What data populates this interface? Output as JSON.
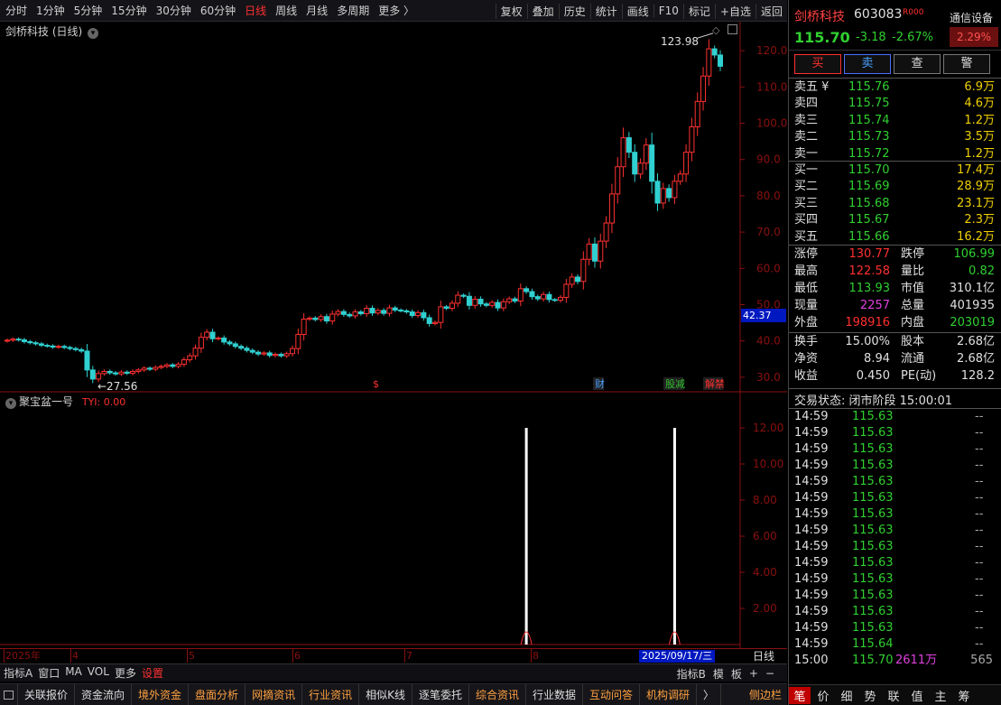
{
  "toolbar": {
    "periods": [
      "分时",
      "1分钟",
      "5分钟",
      "15分钟",
      "30分钟",
      "60分钟",
      "日线",
      "周线",
      "月线",
      "多周期",
      "更多 〉"
    ],
    "active_period": "日线",
    "actions": [
      "复权",
      "叠加",
      "历史",
      "统计",
      "画线",
      "F10",
      "标记",
      "+自选",
      "返回"
    ]
  },
  "chart": {
    "title": "剑桥科技 (日线)",
    "high_label": "123.98",
    "low_label": "←27.56",
    "last_price_tag": "42.37",
    "price_ticks": [
      "120.0",
      "110.0",
      "100.0",
      "90.0",
      "80.0",
      "70.0",
      "60.0",
      "50.0",
      "40.0",
      "30.0"
    ],
    "event_markers": [
      {
        "text": "$",
        "color": "#ff3030"
      },
      {
        "text": "财",
        "color": "#4aa0ff"
      },
      {
        "text": "股减",
        "color": "#30c030"
      },
      {
        "text": "解禁",
        "color": "#ff3030"
      }
    ],
    "indicator_title": "聚宝盆一号",
    "indicator_value": "TYI: 0.00",
    "indicator_ticks": [
      "12.00",
      "10.00",
      "8.00",
      "6.00",
      "4.00",
      "2.00"
    ],
    "time_labels": [
      "2025年",
      "4",
      "5",
      "6",
      "7",
      "8"
    ],
    "cursor_date": "2025/09/17/三",
    "period_label": "日线"
  },
  "chart_data": {
    "type": "candlestick",
    "title": "剑桥科技 (日线)",
    "ylim": [
      24,
      126
    ],
    "y_ticks": [
      30,
      40,
      50,
      60,
      70,
      80,
      90,
      100,
      110,
      120
    ],
    "candles": [
      [
        40,
        40.2
      ],
      [
        40.2,
        40.5
      ],
      [
        40.5,
        40.3
      ],
      [
        40.3,
        39.8
      ],
      [
        39.8,
        39.5
      ],
      [
        39.5,
        39.2
      ],
      [
        39.2,
        38.8
      ],
      [
        38.8,
        38.6
      ],
      [
        38.6,
        38.3
      ],
      [
        38.3,
        38.5
      ],
      [
        38.5,
        38.2
      ],
      [
        38.2,
        37.9
      ],
      [
        37.9,
        37.6
      ],
      [
        37.6,
        37.2
      ],
      [
        37.2,
        32.0
      ],
      [
        32.0,
        29.5
      ],
      [
        29.5,
        31.0
      ],
      [
        31.0,
        31.6
      ],
      [
        31.6,
        31.2
      ],
      [
        31.2,
        30.9
      ],
      [
        30.9,
        31.4
      ],
      [
        31.4,
        31.1
      ],
      [
        31.1,
        31.6
      ],
      [
        31.6,
        32.0
      ],
      [
        32.0,
        32.5
      ],
      [
        32.5,
        32.2
      ],
      [
        32.2,
        32.7
      ],
      [
        32.7,
        33.0
      ],
      [
        33.0,
        33.4
      ],
      [
        33.4,
        33.0
      ],
      [
        33.0,
        33.6
      ],
      [
        33.6,
        34.8
      ],
      [
        34.8,
        35.9
      ],
      [
        35.9,
        38.0
      ],
      [
        38.0,
        41.0
      ],
      [
        41.0,
        42.4
      ],
      [
        42.4,
        40.6
      ],
      [
        40.6,
        40.8
      ],
      [
        40.8,
        39.7
      ],
      [
        39.7,
        39.2
      ],
      [
        39.2,
        38.5
      ],
      [
        38.5,
        38.0
      ],
      [
        38.0,
        37.4
      ],
      [
        37.4,
        36.9
      ],
      [
        36.9,
        36.4
      ],
      [
        36.4,
        36.7
      ],
      [
        36.7,
        36.0
      ],
      [
        36.0,
        36.3
      ],
      [
        36.3,
        35.9
      ],
      [
        35.9,
        36.5
      ],
      [
        36.5,
        37.9
      ],
      [
        37.9,
        41.8
      ],
      [
        41.8,
        46.0
      ],
      [
        46.0,
        46.3
      ],
      [
        46.3,
        45.9
      ],
      [
        45.9,
        46.7
      ],
      [
        46.7,
        45.5
      ],
      [
        45.5,
        47.4
      ],
      [
        47.4,
        48.1
      ],
      [
        48.1,
        47.3
      ],
      [
        47.3,
        46.9
      ],
      [
        46.9,
        48.0
      ],
      [
        48.0,
        47.5
      ],
      [
        47.5,
        49.0
      ],
      [
        49.0,
        47.7
      ],
      [
        47.7,
        48.4
      ],
      [
        48.4,
        47.6
      ],
      [
        47.6,
        49.1
      ],
      [
        49.1,
        48.5
      ],
      [
        48.5,
        48.3
      ],
      [
        48.3,
        48.0
      ],
      [
        48.0,
        47.0
      ],
      [
        47.0,
        47.8
      ],
      [
        47.8,
        46.4
      ],
      [
        46.4,
        44.8
      ],
      [
        44.8,
        45.1
      ],
      [
        45.1,
        49.4
      ],
      [
        49.4,
        49.0
      ],
      [
        49.0,
        50.4
      ],
      [
        50.4,
        52.6
      ],
      [
        52.6,
        52.3
      ],
      [
        52.3,
        49.8
      ],
      [
        49.8,
        51.5
      ],
      [
        51.5,
        50.2
      ],
      [
        50.2,
        49.8
      ],
      [
        49.8,
        50.6
      ],
      [
        50.6,
        49.1
      ],
      [
        49.1,
        50.8
      ],
      [
        50.8,
        51.6
      ],
      [
        51.6,
        51.0
      ],
      [
        51.0,
        54.4
      ],
      [
        54.4,
        53.6
      ],
      [
        53.6,
        52.2
      ],
      [
        52.2,
        51.6
      ],
      [
        51.6,
        52.8
      ],
      [
        52.8,
        51.4
      ],
      [
        51.4,
        51.2
      ],
      [
        51.2,
        52.0
      ],
      [
        52.0,
        55.6
      ],
      [
        55.6,
        57.6
      ],
      [
        57.6,
        56.4
      ],
      [
        56.4,
        62.5
      ],
      [
        62.5,
        66.7
      ],
      [
        66.7,
        62.0
      ],
      [
        62.0,
        67.5
      ],
      [
        67.5,
        72.5
      ],
      [
        72.5,
        80.5
      ],
      [
        80.5,
        88.0
      ],
      [
        88.0,
        96.0
      ],
      [
        96.0,
        92.0
      ],
      [
        92.0,
        86.0
      ],
      [
        86.0,
        89.0
      ],
      [
        89.0,
        94.0
      ],
      [
        94.0,
        84.0
      ],
      [
        84.0,
        78.0
      ],
      [
        78.0,
        82.0
      ],
      [
        82.0,
        79.5
      ],
      [
        79.5,
        84.0
      ],
      [
        84.0,
        86.0
      ],
      [
        86.0,
        92.0
      ],
      [
        92.0,
        99.0
      ],
      [
        99.0,
        106.0
      ],
      [
        106.0,
        113.0
      ],
      [
        113.0,
        120.5
      ],
      [
        120.5,
        118.8
      ],
      [
        118.8,
        115.7
      ]
    ],
    "series": [
      {
        "values": [
          0,
          0,
          0,
          0,
          0,
          0,
          0,
          0,
          0,
          0,
          0,
          0,
          0,
          0,
          0,
          0,
          0,
          0,
          0,
          0,
          0,
          0,
          0,
          0,
          0,
          0,
          0,
          0,
          0,
          0,
          0,
          0,
          0,
          0,
          0,
          0,
          0,
          0,
          0,
          0,
          0,
          0,
          0,
          0,
          0,
          0,
          0,
          0,
          0,
          0,
          0,
          0,
          0,
          0,
          0,
          0,
          0,
          0,
          0,
          0,
          0,
          0,
          0,
          0,
          0,
          0,
          0,
          0,
          0,
          0,
          0,
          0,
          0,
          0,
          0,
          0,
          0,
          0,
          0,
          0,
          0,
          0,
          0,
          0,
          0,
          0,
          0,
          0,
          0,
          0,
          0,
          0,
          0,
          0,
          0,
          0,
          0,
          0,
          0,
          0,
          0,
          0,
          0,
          0,
          0,
          0,
          0,
          0,
          0,
          0,
          0,
          0,
          0,
          0,
          0,
          0,
          0,
          0,
          0,
          0,
          0,
          0,
          0,
          0,
          0,
          0
        ]
      }
    ],
    "indicator_spikes": [
      {
        "index": 91,
        "value": 12
      },
      {
        "index": 117,
        "value": 12
      }
    ],
    "indicator_ylim": [
      0,
      13
    ]
  },
  "quote": {
    "name": "剑桥科技",
    "code": "603083",
    "tag": "R000",
    "device": "通信设备",
    "price": "115.70",
    "change": "-3.18",
    "pct": "-2.67%",
    "device_pct": "2.29%",
    "buttons": [
      "买",
      "卖",
      "查",
      "警"
    ],
    "asks": [
      {
        "label": "卖五 ¥",
        "price": "115.76",
        "vol": "6.9万"
      },
      {
        "label": "卖四",
        "price": "115.75",
        "vol": "4.6万"
      },
      {
        "label": "卖三",
        "price": "115.74",
        "vol": "1.2万"
      },
      {
        "label": "卖二",
        "price": "115.73",
        "vol": "3.5万"
      },
      {
        "label": "卖一",
        "price": "115.72",
        "vol": "1.2万"
      }
    ],
    "bids": [
      {
        "label": "买一",
        "price": "115.70",
        "vol": "17.4万"
      },
      {
        "label": "买二",
        "price": "115.69",
        "vol": "28.9万"
      },
      {
        "label": "买三",
        "price": "115.68",
        "vol": "23.1万"
      },
      {
        "label": "买四",
        "price": "115.67",
        "vol": "2.3万"
      },
      {
        "label": "买五",
        "price": "115.66",
        "vol": "16.2万"
      }
    ],
    "stats1": [
      {
        "l1": "涨停",
        "v1": "130.77",
        "c1": "#ff3030",
        "l2": "跌停",
        "v2": "106.99",
        "c2": "#30d030"
      },
      {
        "l1": "最高",
        "v1": "122.58",
        "c1": "#ff3030",
        "l2": "量比",
        "v2": "0.82",
        "c2": "#30d030"
      },
      {
        "l1": "最低",
        "v1": "113.93",
        "c1": "#30d030",
        "l2": "市值",
        "v2": "310.1亿",
        "c2": "#e0e0e0"
      },
      {
        "l1": "现量",
        "v1": "2257",
        "c1": "#e040e0",
        "l2": "总量",
        "v2": "401935",
        "c2": "#e0e0e0"
      },
      {
        "l1": "外盘",
        "v1": "198916",
        "c1": "#ff3030",
        "l2": "内盘",
        "v2": "203019",
        "c2": "#30d030"
      }
    ],
    "stats2": [
      {
        "l1": "换手",
        "v1": "15.00%",
        "l2": "股本",
        "v2": "2.68亿"
      },
      {
        "l1": "净资",
        "v1": "8.94",
        "l2": "流通",
        "v2": "2.68亿"
      },
      {
        "l1": "收益",
        "v1": "0.450",
        "l2": "PE(动)",
        "v2": "128.2"
      }
    ],
    "status": "交易状态: 闭市阶段 15:00:01",
    "ticks": [
      {
        "t": "14:59",
        "p": "115.63",
        "v": "--",
        "vc": "#aaa"
      },
      {
        "t": "14:59",
        "p": "115.63",
        "v": "--",
        "vc": "#aaa"
      },
      {
        "t": "14:59",
        "p": "115.63",
        "v": "--",
        "vc": "#aaa"
      },
      {
        "t": "14:59",
        "p": "115.63",
        "v": "--",
        "vc": "#aaa"
      },
      {
        "t": "14:59",
        "p": "115.63",
        "v": "--",
        "vc": "#aaa"
      },
      {
        "t": "14:59",
        "p": "115.63",
        "v": "--",
        "vc": "#aaa"
      },
      {
        "t": "14:59",
        "p": "115.63",
        "v": "--",
        "vc": "#aaa"
      },
      {
        "t": "14:59",
        "p": "115.63",
        "v": "--",
        "vc": "#aaa"
      },
      {
        "t": "14:59",
        "p": "115.63",
        "v": "--",
        "vc": "#aaa"
      },
      {
        "t": "14:59",
        "p": "115.63",
        "v": "--",
        "vc": "#aaa"
      },
      {
        "t": "14:59",
        "p": "115.63",
        "v": "--",
        "vc": "#aaa"
      },
      {
        "t": "14:59",
        "p": "115.63",
        "v": "--",
        "vc": "#aaa"
      },
      {
        "t": "14:59",
        "p": "115.63",
        "v": "--",
        "vc": "#aaa"
      },
      {
        "t": "14:59",
        "p": "115.63",
        "v": "--",
        "vc": "#aaa"
      },
      {
        "t": "14:59",
        "p": "115.64",
        "v": "--",
        "vc": "#aaa"
      },
      {
        "t": "15:00",
        "p": "115.70",
        "v": "2611万",
        "vc": "#e040e0",
        "n": "565"
      }
    ],
    "nav": [
      "笔",
      "价",
      "细",
      "势",
      "联",
      "值",
      "主",
      "筹"
    ]
  },
  "bottom": {
    "tabs": [
      "指标A",
      "窗口",
      "MA",
      "VOL",
      "更多",
      "设置"
    ],
    "right_tabs": [
      "指标B",
      "模",
      "板",
      "+",
      "−"
    ],
    "nav": [
      {
        "t": "关联报价",
        "o": false
      },
      {
        "t": "资金流向",
        "o": false
      },
      {
        "t": "境外资金",
        "o": true
      },
      {
        "t": "盘面分析",
        "o": true
      },
      {
        "t": "网摘资讯",
        "o": true
      },
      {
        "t": "行业资讯",
        "o": true
      },
      {
        "t": "相似K线",
        "o": false
      },
      {
        "t": "逐笔委托",
        "o": false
      },
      {
        "t": "综合资讯",
        "o": true
      },
      {
        "t": "行业数据",
        "o": false
      },
      {
        "t": "互动问答",
        "o": true
      },
      {
        "t": "机构调研",
        "o": true
      },
      {
        "t": "〉",
        "o": false
      }
    ],
    "sidebar": "侧边栏"
  },
  "colors": {
    "up": "#ff3030",
    "down": "#30d0d0",
    "grid": "#8a1010",
    "accent": "#ff3030"
  }
}
